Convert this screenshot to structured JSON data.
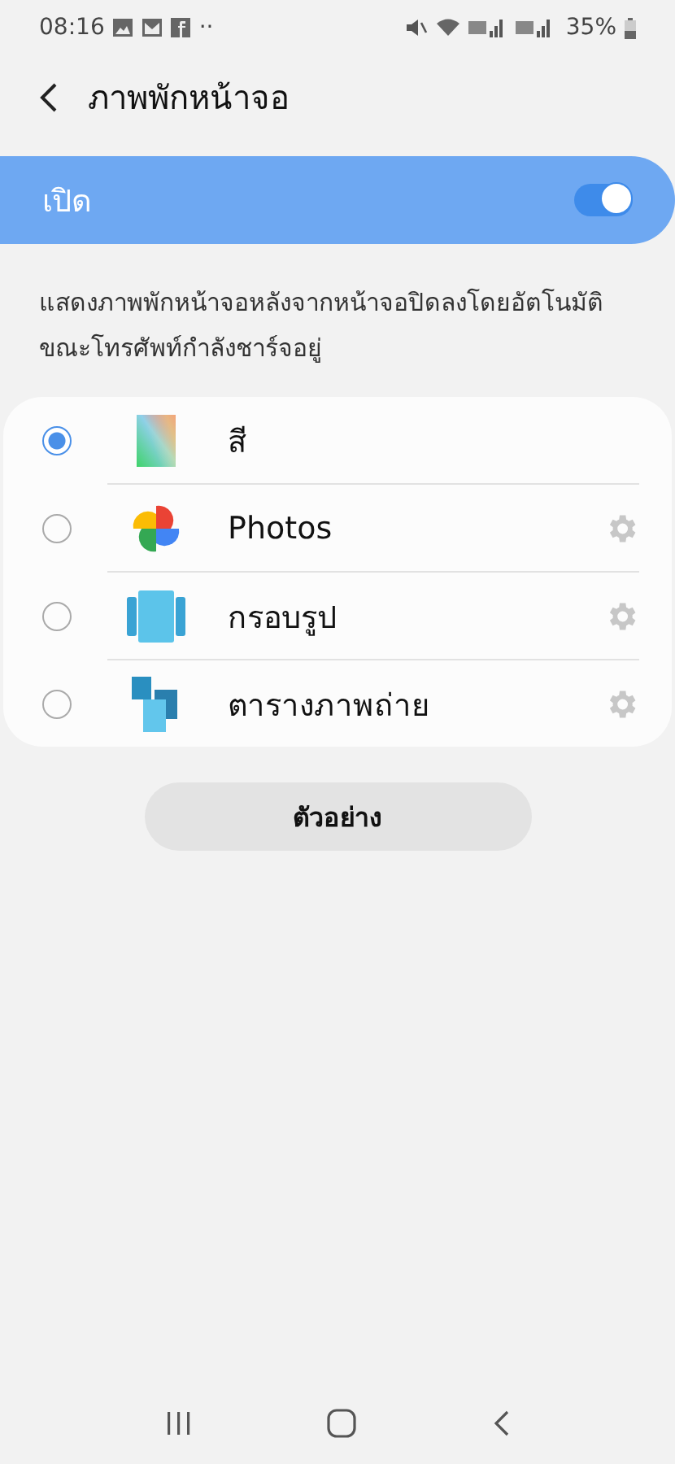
{
  "status_bar": {
    "time": "08:16",
    "more": "··",
    "battery": "35%"
  },
  "header": {
    "title": "ภาพพักหน้าจอ"
  },
  "master_switch": {
    "label": "เปิด",
    "on": true
  },
  "description": "แสดงภาพพักหน้าจอหลังจากหน้าจอปิดลงโดยอัตโนมัติขณะโทรศัพท์กำลังชาร์จอยู่",
  "options": [
    {
      "kind": "colors",
      "label": "สี",
      "selected": true,
      "settings": false
    },
    {
      "kind": "photos",
      "label": "Photos",
      "selected": false,
      "settings": true
    },
    {
      "kind": "frame",
      "label": "กรอบรูป",
      "selected": false,
      "settings": true
    },
    {
      "kind": "table",
      "label": "ตารางภาพถ่าย",
      "selected": false,
      "settings": true
    }
  ],
  "preview_button": "ตัวอย่าง"
}
